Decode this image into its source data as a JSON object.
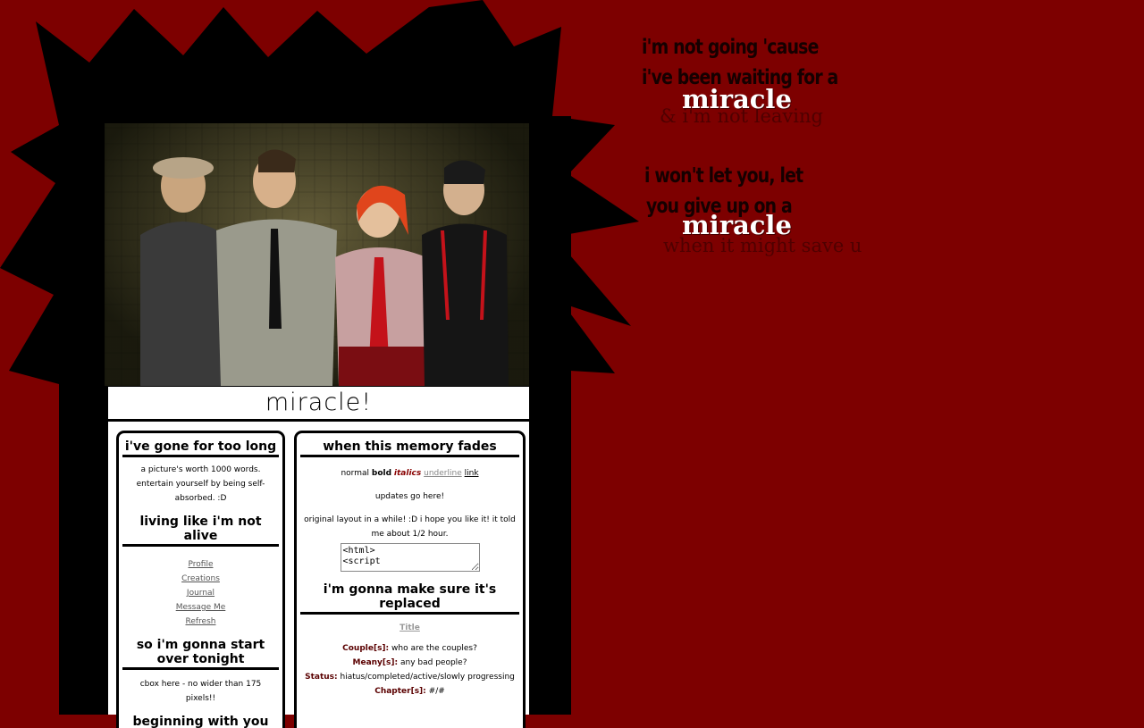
{
  "site": {
    "title": "miracle!"
  },
  "sidebar": {
    "sections": [
      {
        "heading": "i've gone for too long",
        "text": "a picture's worth 1000 words. entertain yourself by being self-absorbed. :D"
      },
      {
        "heading": "living like i'm not alive"
      },
      {
        "heading": "so i'm gonna start over tonight",
        "text": "cbox here - no wider than 175 pixels!!"
      },
      {
        "heading": "beginning with you and i"
      }
    ],
    "nav_links": [
      "Profile",
      "Creations",
      "Journal",
      "Message Me",
      "Refresh"
    ]
  },
  "main": {
    "heading1": "when this memory fades",
    "styles_demo": {
      "normal": "normal",
      "bold": "bold",
      "italics": "italics",
      "underline": "underline",
      "link": "link"
    },
    "updates_text": "updates go here!",
    "intro_text": "original layout in a while! :D i hope you like it! it told me about 1/2 hour.",
    "code_text": "<html>\n<script",
    "heading2": "i'm gonna make sure it's replaced",
    "fic": {
      "title": "Title",
      "rows": [
        {
          "label": "Couple[s]:",
          "value": "who are the couples?"
        },
        {
          "label": "Meany[s]:",
          "value": "any bad people?"
        },
        {
          "label": "Status:",
          "value": "hiatus/completed/active/slowly progressing"
        },
        {
          "label": "Chapter[s]:",
          "value": "#/#"
        }
      ]
    }
  },
  "lyrics": {
    "line1": "i'm not going 'cause",
    "line2": "i've been waiting for a",
    "miracle1": "miracle",
    "faint1": "& i'm not leaving",
    "line3": "i won't let you, let",
    "line4": "you give up on a",
    "miracle2": "miracle",
    "faint2": "when it might save u"
  },
  "colors": {
    "background": "#7d0000",
    "frame": "#000000",
    "panel": "#ffffff",
    "accent_dark": "#5a0000"
  }
}
